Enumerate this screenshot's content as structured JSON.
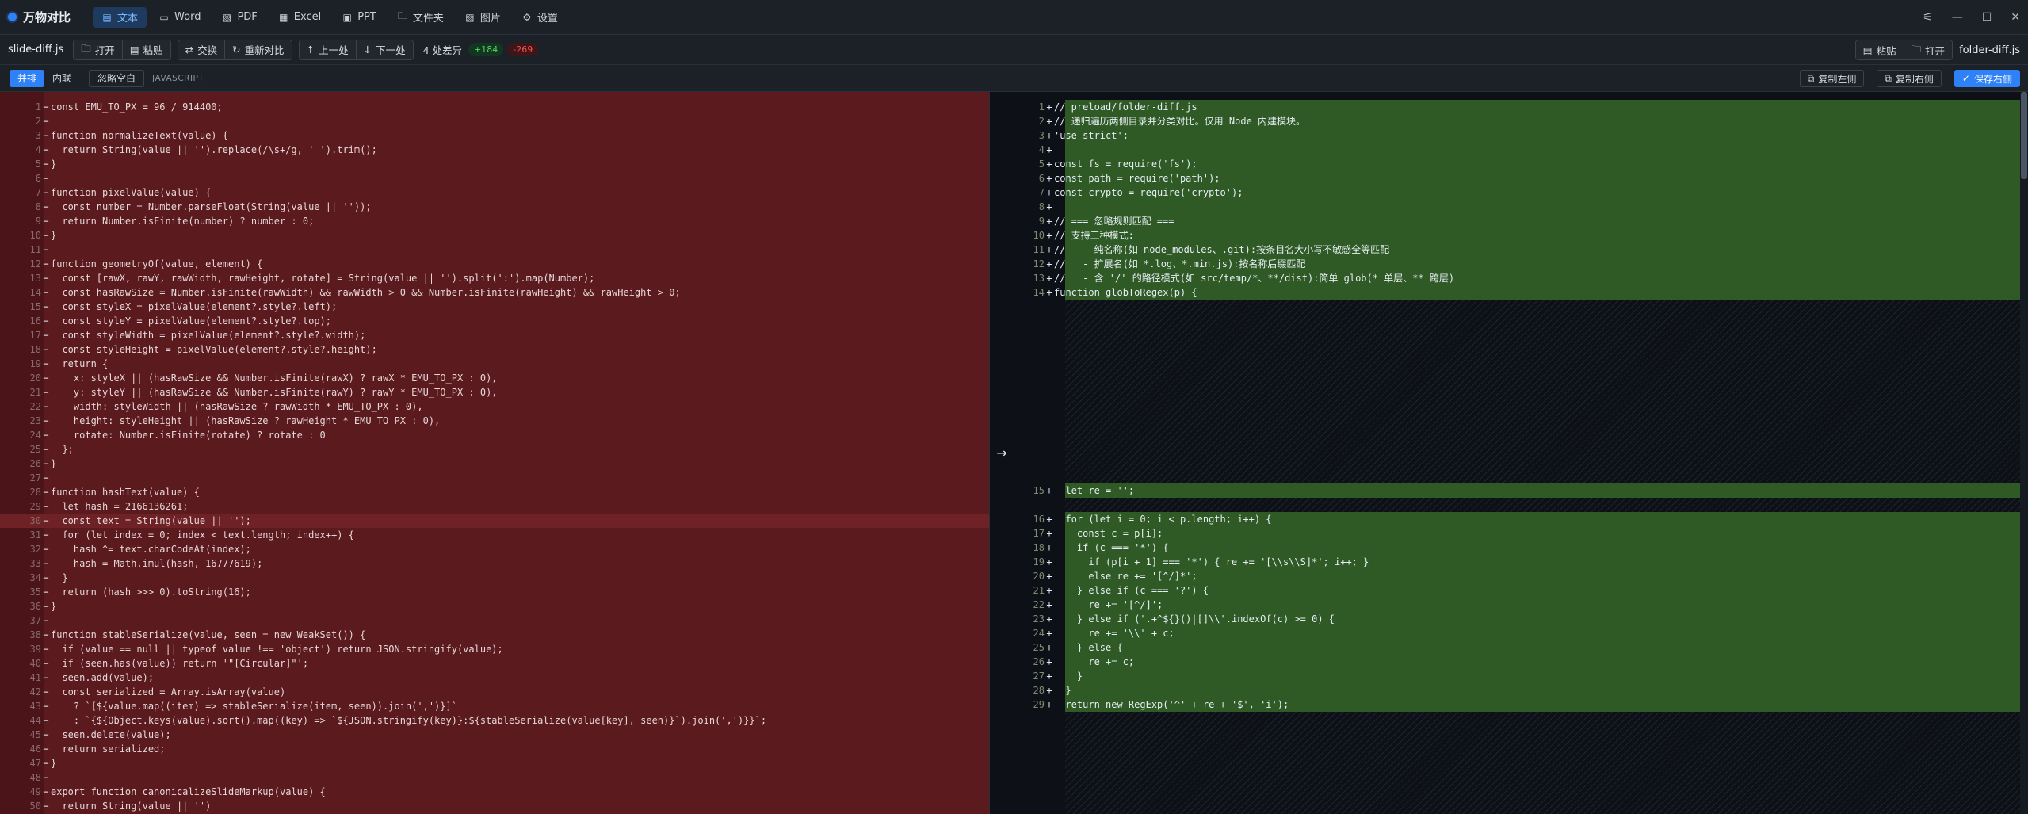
{
  "app": {
    "title": "万物对比",
    "nav": [
      {
        "label": "文本",
        "icon": "document-icon",
        "active": true
      },
      {
        "label": "Word",
        "icon": "book-icon",
        "active": false
      },
      {
        "label": "PDF",
        "icon": "pdf-icon",
        "active": false
      },
      {
        "label": "Excel",
        "icon": "grid-icon",
        "active": false
      },
      {
        "label": "PPT",
        "icon": "slides-icon",
        "active": false
      },
      {
        "label": "文件夹",
        "icon": "folder-icon",
        "active": false
      },
      {
        "label": "图片",
        "icon": "image-icon",
        "active": false
      },
      {
        "label": "设置",
        "icon": "gear-icon",
        "active": false
      }
    ],
    "window_controls": [
      "sliders-icon",
      "minimize-icon",
      "maximize-icon",
      "close-icon"
    ]
  },
  "toolbar": {
    "left_file": "slide-diff.js",
    "open": "打开",
    "paste": "粘贴",
    "swap": "交换",
    "recompare": "重新对比",
    "prev": "上一处",
    "next": "下一处",
    "diff_count": "4 处差异",
    "added": "+184",
    "removed": "-269",
    "right_paste": "粘贴",
    "right_open": "打开",
    "right_file": "folder-diff.js"
  },
  "viewbar": {
    "side_by_side": "并排",
    "inline": "内联",
    "ignore_whitespace": "忽略空白",
    "language": "JAVASCRIPT",
    "copy_left": "复制左侧",
    "copy_right": "复制右侧",
    "save_right": "保存右侧"
  },
  "colors": {
    "accent": "#2f81f7",
    "removed_bg": "#5a1a1e",
    "added_bg": "#2f5a26"
  },
  "left_pane": {
    "lines": [
      {
        "n": "1",
        "m": "−",
        "t": "const EMU_TO_PX = 96 / 914400;"
      },
      {
        "n": "2",
        "m": "−",
        "t": ""
      },
      {
        "n": "3",
        "m": "−",
        "t": "function normalizeText(value) {"
      },
      {
        "n": "4",
        "m": "−",
        "t": "  return String(value || '').replace(/\\s+/g, ' ').trim();"
      },
      {
        "n": "5",
        "m": "−",
        "t": "}"
      },
      {
        "n": "6",
        "m": "−",
        "t": ""
      },
      {
        "n": "7",
        "m": "−",
        "t": "function pixelValue(value) {"
      },
      {
        "n": "8",
        "m": "−",
        "t": "  const number = Number.parseFloat(String(value || ''));"
      },
      {
        "n": "9",
        "m": "−",
        "t": "  return Number.isFinite(number) ? number : 0;"
      },
      {
        "n": "10",
        "m": "−",
        "t": "}"
      },
      {
        "n": "11",
        "m": "−",
        "t": ""
      },
      {
        "n": "12",
        "m": "−",
        "t": "function geometryOf(value, element) {"
      },
      {
        "n": "13",
        "m": "−",
        "t": "  const [rawX, rawY, rawWidth, rawHeight, rotate] = String(value || '').split(':').map(Number);"
      },
      {
        "n": "14",
        "m": "−",
        "t": "  const hasRawSize = Number.isFinite(rawWidth) && rawWidth > 0 && Number.isFinite(rawHeight) && rawHeight > 0;"
      },
      {
        "n": "15",
        "m": "−",
        "t": "  const styleX = pixelValue(element?.style?.left);"
      },
      {
        "n": "16",
        "m": "−",
        "t": "  const styleY = pixelValue(element?.style?.top);"
      },
      {
        "n": "17",
        "m": "−",
        "t": "  const styleWidth = pixelValue(element?.style?.width);"
      },
      {
        "n": "18",
        "m": "−",
        "t": "  const styleHeight = pixelValue(element?.style?.height);"
      },
      {
        "n": "19",
        "m": "−",
        "t": "  return {"
      },
      {
        "n": "20",
        "m": "−",
        "t": "    x: styleX || (hasRawSize && Number.isFinite(rawX) ? rawX * EMU_TO_PX : 0),"
      },
      {
        "n": "21",
        "m": "−",
        "t": "    y: styleY || (hasRawSize && Number.isFinite(rawY) ? rawY * EMU_TO_PX : 0),"
      },
      {
        "n": "22",
        "m": "−",
        "t": "    width: styleWidth || (hasRawSize ? rawWidth * EMU_TO_PX : 0),"
      },
      {
        "n": "23",
        "m": "−",
        "t": "    height: styleHeight || (hasRawSize ? rawHeight * EMU_TO_PX : 0),"
      },
      {
        "n": "24",
        "m": "−",
        "t": "    rotate: Number.isFinite(rotate) ? rotate : 0"
      },
      {
        "n": "25",
        "m": "−",
        "t": "  };"
      },
      {
        "n": "26",
        "m": "−",
        "t": "}"
      },
      {
        "n": "27",
        "m": "−",
        "t": ""
      },
      {
        "n": "28",
        "m": "−",
        "t": "function hashText(value) {"
      },
      {
        "n": "29",
        "m": "−",
        "t": "  let hash = 2166136261;"
      },
      {
        "n": "30",
        "m": "−",
        "t": "  const text = String(value || '');"
      },
      {
        "n": "31",
        "m": "−",
        "t": "  for (let index = 0; index < text.length; index++) {"
      },
      {
        "n": "32",
        "m": "−",
        "t": "    hash ^= text.charCodeAt(index);"
      },
      {
        "n": "33",
        "m": "−",
        "t": "    hash = Math.imul(hash, 16777619);"
      },
      {
        "n": "34",
        "m": "−",
        "t": "  }"
      },
      {
        "n": "35",
        "m": "−",
        "t": "  return (hash >>> 0).toString(16);"
      },
      {
        "n": "36",
        "m": "−",
        "t": "}"
      },
      {
        "n": "37",
        "m": "−",
        "t": ""
      },
      {
        "n": "38",
        "m": "−",
        "t": "function stableSerialize(value, seen = new WeakSet()) {"
      },
      {
        "n": "39",
        "m": "−",
        "t": "  if (value == null || typeof value !== 'object') return JSON.stringify(value);"
      },
      {
        "n": "40",
        "m": "−",
        "t": "  if (seen.has(value)) return '\"[Circular]\"';"
      },
      {
        "n": "41",
        "m": "−",
        "t": "  seen.add(value);"
      },
      {
        "n": "42",
        "m": "−",
        "t": "  const serialized = Array.isArray(value)"
      },
      {
        "n": "43",
        "m": "−",
        "t": "    ? `[${value.map((item) => stableSerialize(item, seen)).join(',')}]`"
      },
      {
        "n": "44",
        "m": "−",
        "t": "    : `{${Object.keys(value).sort().map((key) => `${JSON.stringify(key)}:${stableSerialize(value[key], seen)}`).join(',')}}`;"
      },
      {
        "n": "45",
        "m": "−",
        "t": "  seen.delete(value);"
      },
      {
        "n": "46",
        "m": "−",
        "t": "  return serialized;"
      },
      {
        "n": "47",
        "m": "−",
        "t": "}"
      },
      {
        "n": "48",
        "m": "−",
        "t": ""
      },
      {
        "n": "49",
        "m": "−",
        "t": "export function canonicalizeSlideMarkup(value) {"
      },
      {
        "n": "50",
        "m": "−",
        "t": "  return String(value || '')"
      }
    ]
  },
  "right_pane": {
    "block1": [
      {
        "n": "1",
        "m": "+",
        "t": "// preload/folder-diff.js"
      },
      {
        "n": "2",
        "m": "+",
        "t": "// 递归遍历两侧目录并分类对比。仅用 Node 内建模块。"
      },
      {
        "n": "3",
        "m": "+",
        "t": "'use strict';"
      },
      {
        "n": "4",
        "m": "+",
        "t": ""
      },
      {
        "n": "5",
        "m": "+",
        "t": "const fs = require('fs');"
      },
      {
        "n": "6",
        "m": "+",
        "t": "const path = require('path');"
      },
      {
        "n": "7",
        "m": "+",
        "t": "const crypto = require('crypto');"
      },
      {
        "n": "8",
        "m": "+",
        "t": ""
      },
      {
        "n": "9",
        "m": "+",
        "t": "// === 忽略规则匹配 ==="
      },
      {
        "n": "10",
        "m": "+",
        "t": "// 支持三种模式:"
      },
      {
        "n": "11",
        "m": "+",
        "t": "//   - 纯名称(如 node_modules、.git):按条目名大小写不敏感全等匹配"
      },
      {
        "n": "12",
        "m": "+",
        "t": "//   - 扩展名(如 *.log、*.min.js):按名称后缀匹配"
      },
      {
        "n": "13",
        "m": "+",
        "t": "//   - 含 '/' 的路径模式(如 src/temp/*、**/dist):简单 glob(* 单层、** 跨层)"
      },
      {
        "n": "14",
        "m": "+",
        "t": "function globToRegex(p) {"
      }
    ],
    "block2": [
      {
        "n": "15",
        "m": "+",
        "t": "  let re = '';"
      }
    ],
    "block3": [
      {
        "n": "16",
        "m": "+",
        "t": "  for (let i = 0; i < p.length; i++) {"
      },
      {
        "n": "17",
        "m": "+",
        "t": "    const c = p[i];"
      },
      {
        "n": "18",
        "m": "+",
        "t": "    if (c === '*') {"
      },
      {
        "n": "19",
        "m": "+",
        "t": "      if (p[i + 1] === '*') { re += '[\\\\s\\\\S]*'; i++; }"
      },
      {
        "n": "20",
        "m": "+",
        "t": "      else re += '[^/]*';"
      },
      {
        "n": "21",
        "m": "+",
        "t": "    } else if (c === '?') {"
      },
      {
        "n": "22",
        "m": "+",
        "t": "      re += '[^/]';"
      },
      {
        "n": "23",
        "m": "+",
        "t": "    } else if ('.+^${}()|[]\\\\'.indexOf(c) >= 0) {"
      },
      {
        "n": "24",
        "m": "+",
        "t": "      re += '\\\\' + c;"
      },
      {
        "n": "25",
        "m": "+",
        "t": "    } else {"
      },
      {
        "n": "26",
        "m": "+",
        "t": "      re += c;"
      },
      {
        "n": "27",
        "m": "+",
        "t": "    }"
      },
      {
        "n": "28",
        "m": "+",
        "t": "  }"
      },
      {
        "n": "29",
        "m": "+",
        "t": "  return new RegExp('^' + re + '$', 'i');"
      }
    ]
  }
}
